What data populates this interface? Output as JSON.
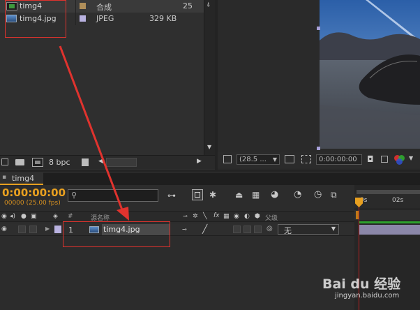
{
  "project": {
    "rows": [
      {
        "name": "timg4",
        "type": "合成",
        "size": "25"
      },
      {
        "name": "timg4.jpg",
        "type": "JPEG",
        "size": "329 KB"
      }
    ],
    "bpc_label": "8 bpc"
  },
  "viewer": {
    "zoom": "(28.5 ...",
    "timecode": "0:00:00:00"
  },
  "timeline": {
    "tab_label": "timg4",
    "current_time": "0:00:00:00",
    "frame_info": "00000 (25.00 fps)",
    "search_placeholder": "",
    "col_number": "#",
    "col_source_name": "源名称",
    "col_parent": "父级",
    "ruler_marks": [
      "0s",
      "02s"
    ],
    "layers": [
      {
        "index": "1",
        "name": "timg4.jpg",
        "parent": "无"
      }
    ]
  },
  "colors": {
    "accent_orange": "#e8a020",
    "annotation_red": "#e0332e",
    "playhead_red": "#b82020",
    "work_area_green": "#2ca02c",
    "label_lavender": "#b9b2e0"
  },
  "watermark": {
    "brand": "Bai du 经验",
    "url": "jingyan.baidu.com"
  }
}
